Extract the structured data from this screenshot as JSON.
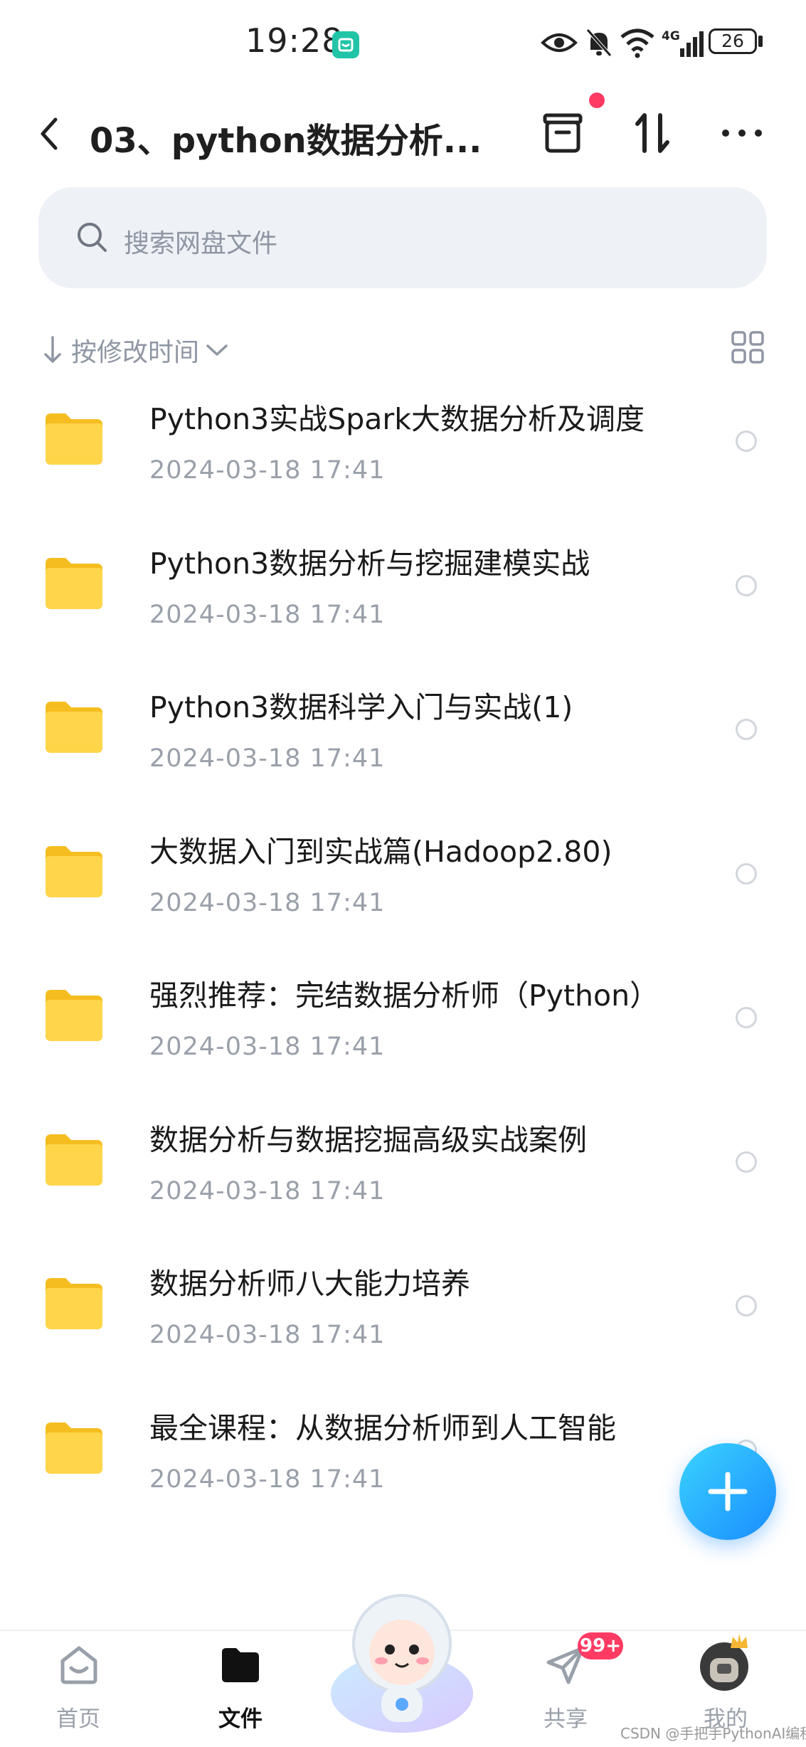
{
  "status_bar": {
    "time": "19:28",
    "battery": "26"
  },
  "nav": {
    "title": "03、python数据分析..."
  },
  "search": {
    "placeholder": "搜索网盘文件"
  },
  "sort": {
    "label": "按修改时间"
  },
  "files": [
    {
      "name": "Python3实战Spark大数据分析及调度",
      "date": "2024-03-18  17:41"
    },
    {
      "name": "Python3数据分析与挖掘建模实战",
      "date": "2024-03-18  17:41"
    },
    {
      "name": "Python3数据科学入门与实战(1)",
      "date": "2024-03-18  17:41"
    },
    {
      "name": "大数据入门到实战篇(Hadoop2.80)",
      "date": "2024-03-18  17:41"
    },
    {
      "name": "强烈推荐：完结数据分析师（Python）",
      "date": "2024-03-18  17:41"
    },
    {
      "name": "数据分析与数据挖掘高级实战案例",
      "date": "2024-03-18  17:41"
    },
    {
      "name": "数据分析师八大能力培养",
      "date": "2024-03-18  17:41"
    },
    {
      "name": "最全课程：从数据分析师到人工智能",
      "date": "2024-03-18  17:41"
    }
  ],
  "tabs": [
    {
      "label": "首页"
    },
    {
      "label": "文件"
    },
    {
      "label": "共享",
      "badge": "99+"
    },
    {
      "label": "我的"
    }
  ],
  "watermark": "CSDN @手把手PythonAI编程",
  "colors": {
    "accent": "#1a8cff",
    "folder": "#ffd23f",
    "badge": "#ff3b63"
  }
}
